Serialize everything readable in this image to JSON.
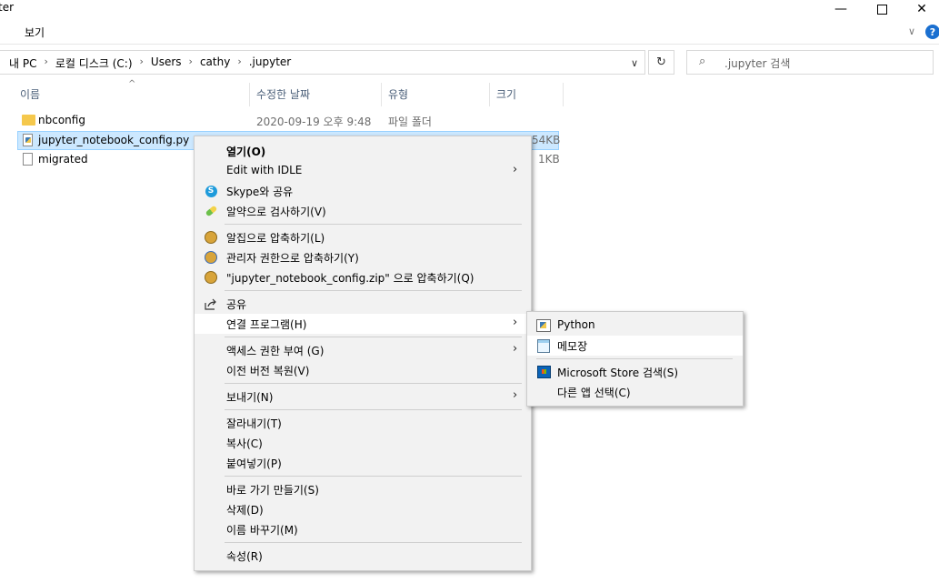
{
  "window": {
    "title": "ter",
    "minimize_glyph": "—",
    "close_glyph": "✕"
  },
  "ribbon": {
    "view_tab": "보기",
    "expand_glyph": "∨",
    "help_glyph": "?"
  },
  "address": {
    "crumbs": [
      "내 PC",
      "로컬 디스크 (C:)",
      "Users",
      "cathy",
      ".jupyter"
    ],
    "separator": "›",
    "dropdown_glyph": "∨",
    "refresh_glyph": "↻"
  },
  "search": {
    "placeholder": ".jupyter 검색",
    "icon_glyph": "⌕"
  },
  "columns": {
    "name": "이름",
    "date": "수정한 날짜",
    "type": "유형",
    "size": "크기",
    "sort_glyph": "^"
  },
  "files": [
    {
      "name": "nbconfig",
      "date": "2020-09-19 오후 9:48",
      "type": "파일 폴더",
      "size": "",
      "icon": "folder-icon"
    },
    {
      "name": "jupyter_notebook_config.py",
      "date": "",
      "type": "",
      "size": "54KB",
      "icon": "python-file-icon"
    },
    {
      "name": "migrated",
      "date": "",
      "type": "",
      "size": "1KB",
      "icon": "file-icon"
    }
  ],
  "context_menu": {
    "open": "열기(O)",
    "edit_idle": "Edit with IDLE",
    "skype_share": "Skype와 공유",
    "alyac_scan": "알약으로 검사하기(V)",
    "alzip_compress": "알집으로 압축하기(L)",
    "admin_compress": "관리자 권한으로 압축하기(Y)",
    "zip_compress": "\"jupyter_notebook_config.zip\" 으로 압축하기(Q)",
    "share": "공유",
    "open_with": "연결 프로그램(H)",
    "grant_access": "액세스 권한 부여 (G)",
    "restore_versions": "이전 버전 복원(V)",
    "send_to": "보내기(N)",
    "cut": "잘라내기(T)",
    "copy": "복사(C)",
    "paste": "붙여넣기(P)",
    "create_shortcut": "바로 가기 만들기(S)",
    "delete": "삭제(D)",
    "rename": "이름 바꾸기(M)",
    "properties": "속성(R)",
    "submenu_arrow": "›",
    "skype_glyph": "S"
  },
  "open_with_menu": {
    "python": "Python",
    "notepad": "메모장",
    "store_search": "Microsoft Store 검색(S)",
    "choose_app": "다른 앱 선택(C)"
  },
  "colors": {
    "selection_bg": "#cce8ff",
    "selection_border": "#99d1ff",
    "menu_bg": "#f2f2f2",
    "header_text": "#4c607a",
    "help_blue": "#1a6fd0"
  }
}
